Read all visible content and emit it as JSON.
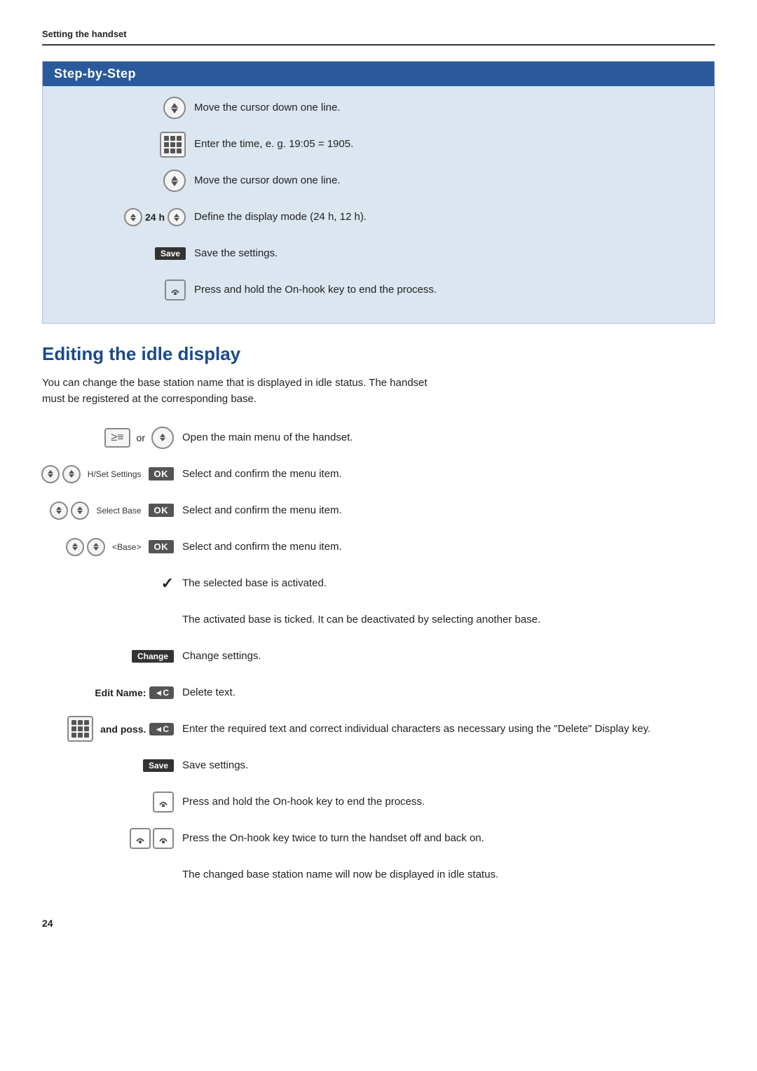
{
  "page": {
    "header": "Setting the handset",
    "page_number": "24"
  },
  "step_by_step": {
    "title": "Step-by-Step",
    "steps": [
      {
        "id": "move1",
        "icon_type": "nav",
        "text": "Move the cursor down one line."
      },
      {
        "id": "keypad1",
        "icon_type": "keypad",
        "text": "Enter the time, e. g. 19:05 = 1905."
      },
      {
        "id": "move2",
        "icon_type": "nav",
        "text": "Move the cursor down one line."
      },
      {
        "id": "24h",
        "icon_type": "24h",
        "text": "Define the display mode (24 h, 12 h)."
      },
      {
        "id": "save1",
        "icon_type": "save",
        "text": "Save the settings."
      },
      {
        "id": "onhook1",
        "icon_type": "onhook",
        "text": "Press and hold the On-hook key to end the process."
      }
    ]
  },
  "editing_section": {
    "heading": "Editing the idle display",
    "intro": "You can change the base station name that is displayed in idle status. The handset must be registered at the corresponding base.",
    "steps": [
      {
        "id": "open_menu",
        "icon_type": "menu_or_nav",
        "text": "Open the main menu of the handset."
      },
      {
        "id": "hset",
        "icon_type": "nav_ok",
        "menu_label": "H/Set Settings",
        "text": "Select and confirm the menu item."
      },
      {
        "id": "select_base",
        "icon_type": "nav_ok",
        "menu_label": "Select Base",
        "text": "Select and confirm the menu item."
      },
      {
        "id": "base",
        "icon_type": "nav_ok",
        "menu_label": "<Base>",
        "text": "Select and confirm the menu item."
      },
      {
        "id": "activated",
        "icon_type": "checkmark",
        "text": "The selected base is activated."
      },
      {
        "id": "deactivated_info",
        "icon_type": "none",
        "text": "The activated base is ticked. It can be deactivated by selecting another base."
      },
      {
        "id": "change",
        "icon_type": "change",
        "text": "Change settings."
      },
      {
        "id": "edit_name",
        "icon_type": "edit_name",
        "text": "Delete text."
      },
      {
        "id": "keypad_poss",
        "icon_type": "keypad_poss",
        "text": "Enter the required text and correct individual characters as necessary using the \"Delete\" Display key."
      },
      {
        "id": "save2",
        "icon_type": "save",
        "text": "Save settings."
      },
      {
        "id": "onhook2",
        "icon_type": "onhook",
        "text": "Press and hold the On-hook key to end the process."
      },
      {
        "id": "onhook_twice",
        "icon_type": "onhook_twice",
        "text": "Press the On-hook key twice to turn the handset off and back on."
      },
      {
        "id": "idle_status",
        "icon_type": "none",
        "text": "The changed base station name will now be displayed in idle status."
      }
    ]
  },
  "buttons": {
    "save": "Save",
    "ok": "OK",
    "change": "Change",
    "delete_c": "◄C"
  }
}
